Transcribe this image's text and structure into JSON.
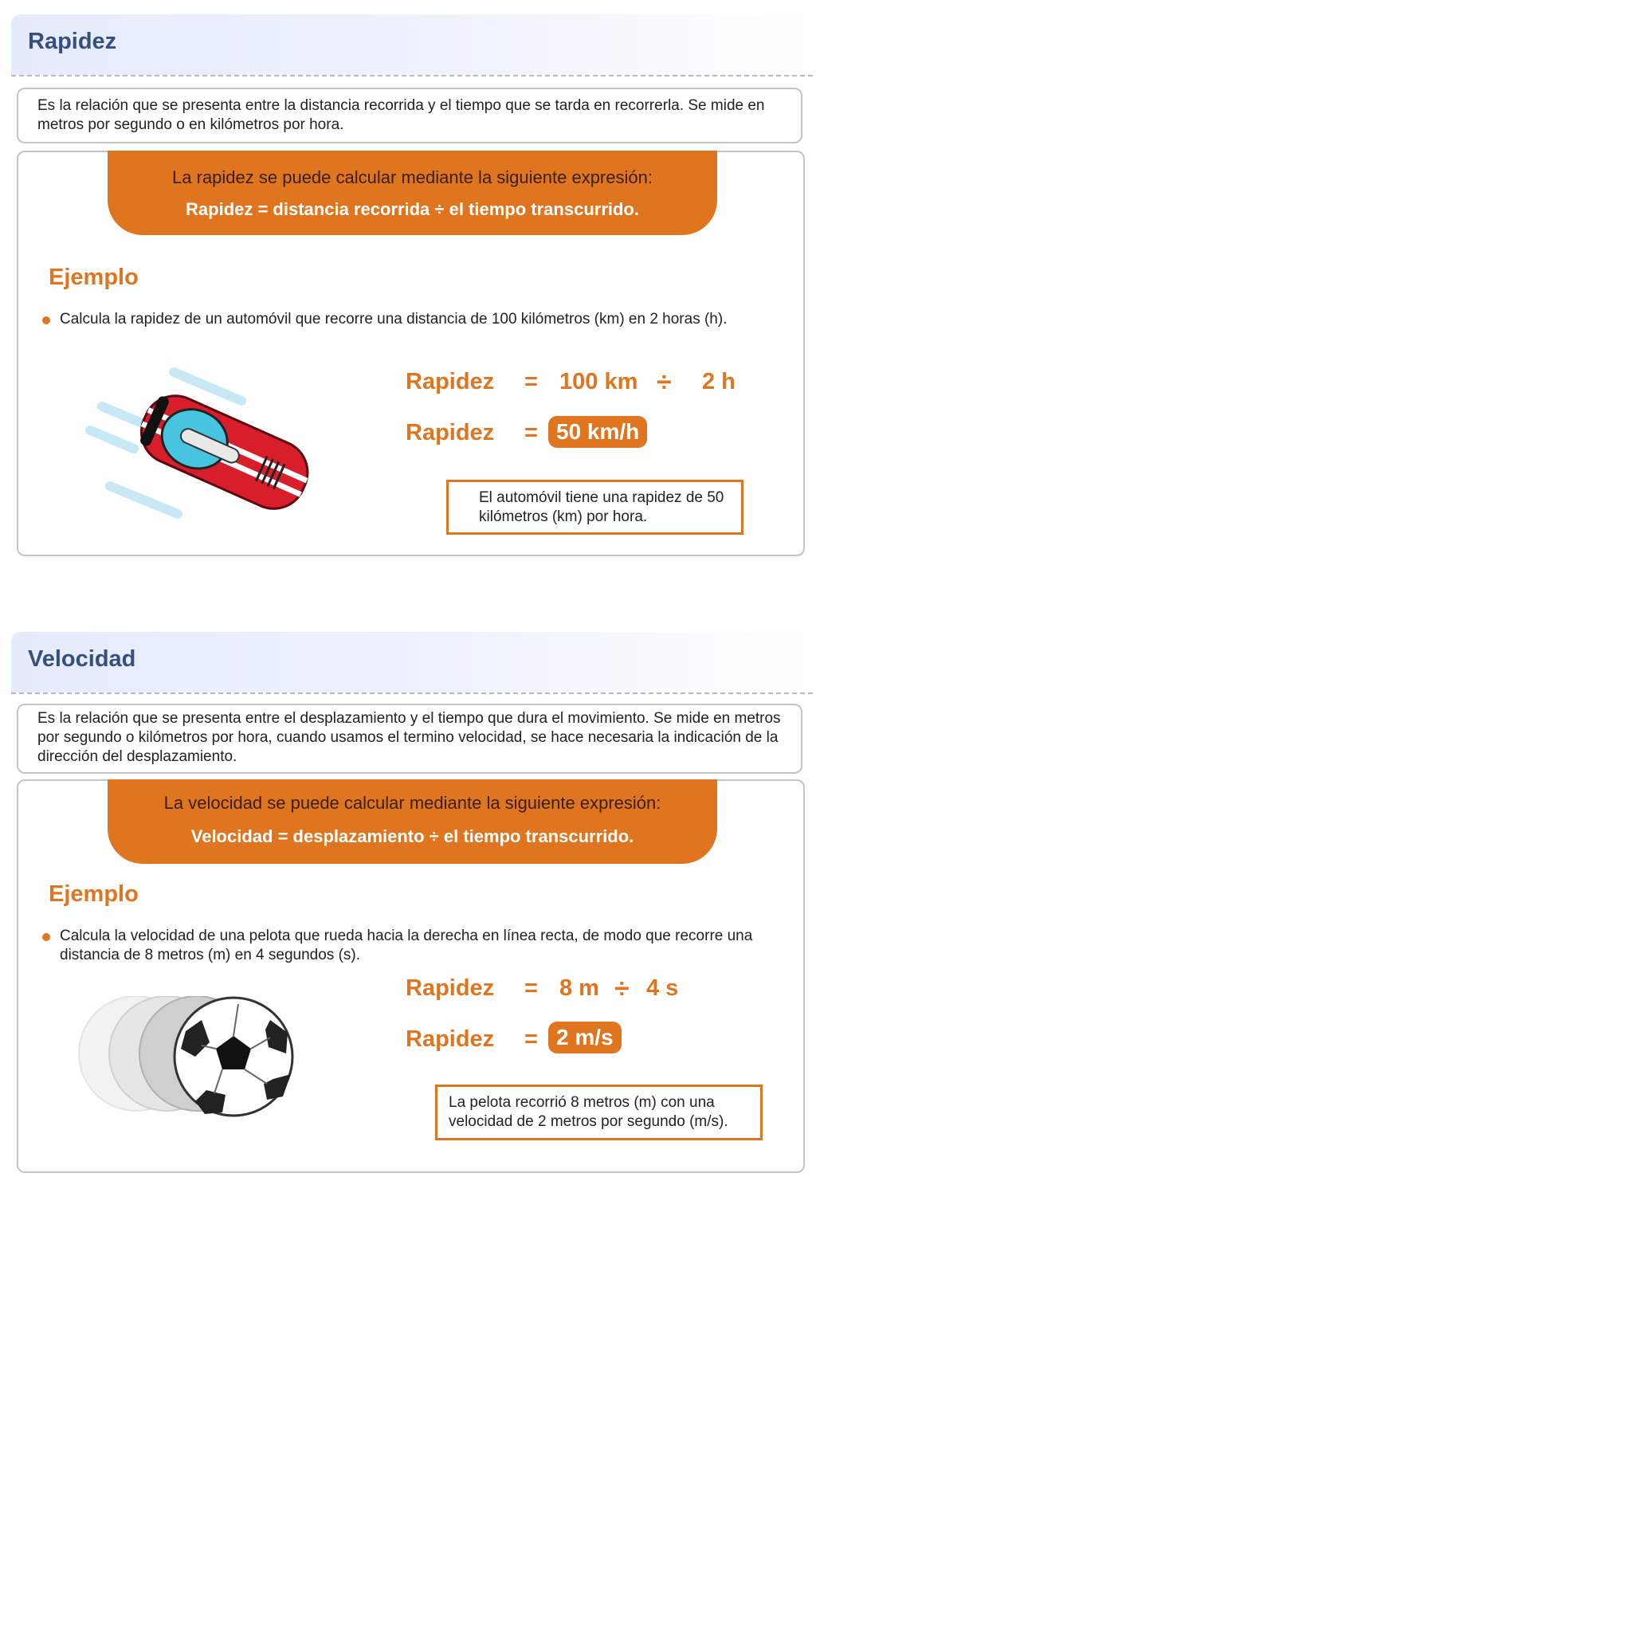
{
  "sections": [
    {
      "title": "Rapidez",
      "definition": "Es la relación que se presenta entre la distancia recorrida y el tiempo que se tarda en recorrerla. Se mide en metros por segundo o en kilómetros por hora.",
      "formula_intro": "La rapidez se puede calcular mediante la siguiente expresión:",
      "formula": "Rapidez = distancia recorrida ÷ el tiempo transcurrido.",
      "example_heading": "Ejemplo",
      "example_text": "Calcula la rapidez de un automóvil que recorre una distancia de 100 kilómetros (km) en 2 horas (h).",
      "eq1_label": "Rapidez",
      "eq1_equals": "=",
      "eq1_a": "100 km",
      "eq1_op": "÷",
      "eq1_b": "2 h",
      "eq2_label": "Rapidez",
      "eq2_equals": "=",
      "eq2_result": "50 km/h",
      "result_text": "El automóvil tiene una rapidez de 50 kilómetros (km) por hora.",
      "illustration": "red-race-car"
    },
    {
      "title": "Velocidad",
      "definition": "Es la relación que se presenta entre el desplazamiento y el tiempo que dura el movimiento. Se mide en metros por segundo o kilómetros por hora, cuando usamos el termino velocidad, se hace necesaria la indicación de la dirección del desplazamiento.",
      "formula_intro": "La velocidad se puede calcular mediante la siguiente expresión:",
      "formula": "Velocidad = desplazamiento ÷ el tiempo transcurrido.",
      "example_heading": "Ejemplo",
      "example_text": "Calcula la velocidad de una pelota que rueda hacia la derecha en línea recta, de modo que recorre una distancia de 8 metros (m) en 4 segundos (s).",
      "eq1_label": "Rapidez",
      "eq1_equals": "=",
      "eq1_a": "8 m",
      "eq1_op": "÷",
      "eq1_b": "4 s",
      "eq2_label": "Rapidez",
      "eq2_equals": "=",
      "eq2_result": "2 m/s",
      "result_text": "La pelota recorrió 8 metros (m) con una velocidad de 2 metros por segundo (m/s).",
      "illustration": "rolling-soccer-ball"
    }
  ],
  "colors": {
    "accent": "#e07520",
    "title": "#36507e",
    "border": "#c4c4c4"
  }
}
